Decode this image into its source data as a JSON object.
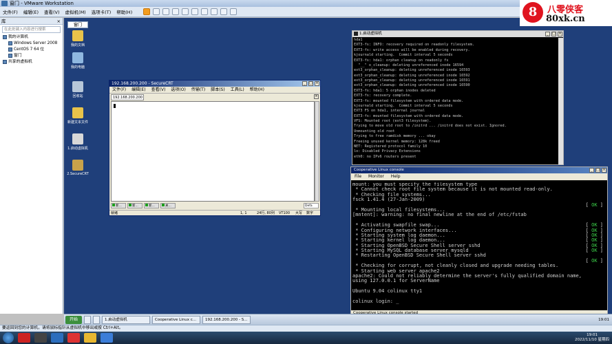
{
  "host": {
    "title": "窗门 - VMware Workstation",
    "menu": [
      "文件(F)",
      "编辑(E)",
      "查看(V)",
      "虚拟机(M)",
      "选项卡(T)",
      "帮助(H)"
    ],
    "status": "要返回到您的计算机，请将鼠标指针从虚拟机中移出或按 Ctrl+Alt。",
    "clock_time": "19:01",
    "clock_date": "2022/11/10 星期四"
  },
  "library": {
    "title": "库",
    "close": "×",
    "search_placeholder": "在此处键入内容进行搜索",
    "items": [
      {
        "label": "我的计算机"
      },
      {
        "label": "Windows Server 2008"
      },
      {
        "label": "CentOS 7 64 位"
      },
      {
        "label": "窗门"
      },
      {
        "label": "共享的虚拟机"
      }
    ]
  },
  "vm_tab": "窗门",
  "desktop_icons": [
    {
      "label": "我的文档",
      "icon": "folder-icon"
    },
    {
      "label": "我的电脑",
      "icon": "computer-icon"
    },
    {
      "label": "回收站",
      "icon": "recycle-bin-icon"
    },
    {
      "label": "新建文本文件",
      "icon": "folder-icon"
    },
    {
      "label": "1.启动虚拟机",
      "icon": "shortcut-icon"
    },
    {
      "label": "2.SecureCRT",
      "icon": "securecrt-icon"
    }
  ],
  "guest_taskbar": {
    "start": "开始",
    "buttons": [
      "1.启动虚拟机",
      "Cooperative Linux c...",
      "192.168.200.200 - S..."
    ],
    "clock": "19:01"
  },
  "securecrt": {
    "title": "192.168.200.200 - SecureCRT",
    "menu": [
      "文件(F)",
      "编辑(E)",
      "查看(V)",
      "选项(O)",
      "传输(T)",
      "脚本(S)",
      "工具(L)",
      "帮助(H)"
    ],
    "tab": "192.168.200.200",
    "session_buttons": [
      "新...",
      "新...",
      "新...",
      "关..."
    ],
    "default_select": "Defa",
    "status_ready": "就绪",
    "status_pos": "1, 1",
    "status_size": "24行, 80列",
    "status_term": "VT100",
    "status_caps": "大写",
    "status_num": "数字"
  },
  "console": {
    "title": "1.启动虚拟机",
    "lines": [
      "hda1",
      "EXT3-fs: INFO: recovery required on readonly filesystem.",
      "EXT3-fs: write access will be enabled during recovery.",
      "kjournald starting.  Commit interval 5 seconds",
      "EXT3-fs: hda1: orphan cleanup on readonly fs",
      "  \"__\" o_cleanup: deleting unreferenced inode 16594",
      "ext3_orphan_cleanup: deleting unreferenced inode 16593",
      "ext3_orphan_cleanup: deleting unreferenced inode 16592",
      "ext3_orphan_cleanup: deleting unreferenced inode 16591",
      "ext3_orphan_cleanup: deleting unreferenced inode 16590",
      "EXT3-fs: hda1: 5 orphan inodes deleted",
      "EXT3-fs: recovery complete.",
      "EXT3-fs: mounted filesystem with ordered data mode.",
      "kjournald starting.  Commit interval 5 seconds",
      "EXT3 FS on hda1, internal journal",
      "EXT3-fs: mounted filesystem with ordered data mode.",
      "VFS: Mounted root (ext3 filesystem).",
      "Trying to move old root to /initrd ... /initrd does not exist. Ignored.",
      "Unmounting old root",
      "Trying to free ramdisk memory ... okay",
      "Freeing unused kernel memory: 128k freed",
      "NET: Registered protocol family 10",
      "lo: Disabled Privacy Extensions",
      "eth0: no IPv6 routers present"
    ]
  },
  "colinux": {
    "title": "Cooperative Linux console",
    "menu": [
      "File",
      "Monitor",
      "Help"
    ],
    "ok": "[ OK ]",
    "lines": [
      {
        "text": "mount: you must specify the filesystem type",
        "ok": false
      },
      {
        "text": " * Cannot check root file system because it is not mounted read-only.",
        "ok": false
      },
      {
        "text": " * Checking file systems...",
        "ok": false
      },
      {
        "text": "fsck 1.41.4 (27-Jan-2009)",
        "ok": false
      },
      {
        "text": "",
        "ok": true
      },
      {
        "text": " * Mounting local filesystems...",
        "ok": false
      },
      {
        "text": "[mntent]: warning: no final newline at the end of /etc/fstab",
        "ok": false
      },
      {
        "text": "",
        "ok": false
      },
      {
        "text": " * Activating swapfile swap...",
        "ok": true
      },
      {
        "text": " * Configuring network interfaces...",
        "ok": true
      },
      {
        "text": " * Starting system log daemon...",
        "ok": true
      },
      {
        "text": " * Starting kernel log daemon...",
        "ok": true
      },
      {
        "text": " * Starting OpenBSD Secure Shell server sshd",
        "ok": true
      },
      {
        "text": " * Starting MySQL database server mysqld",
        "ok": true
      },
      {
        "text": " * Restarting OpenBSD Secure Shell server sshd",
        "ok": false
      },
      {
        "text": "",
        "ok": true
      },
      {
        "text": " * Checking for corrupt, not cleanly closed and upgrade needing tables.",
        "ok": false
      },
      {
        "text": " * Starting web server apache2",
        "ok": false
      },
      {
        "text": "apache2: Could not reliably determine the server's fully qualified domain name,",
        "ok": false
      },
      {
        "text": "using 127.0.0.1 for ServerName",
        "ok": false
      },
      {
        "text": "",
        "ok": false
      },
      {
        "text": "Ubuntu 9.04 colinux tty1",
        "ok": false
      },
      {
        "text": "",
        "ok": false
      },
      {
        "text": "colinux login: _",
        "ok": false
      }
    ],
    "status": "Cooperative Linux console started"
  },
  "watermark": {
    "logo": "8",
    "top": "八零侠客",
    "url": "80xk.cn"
  }
}
